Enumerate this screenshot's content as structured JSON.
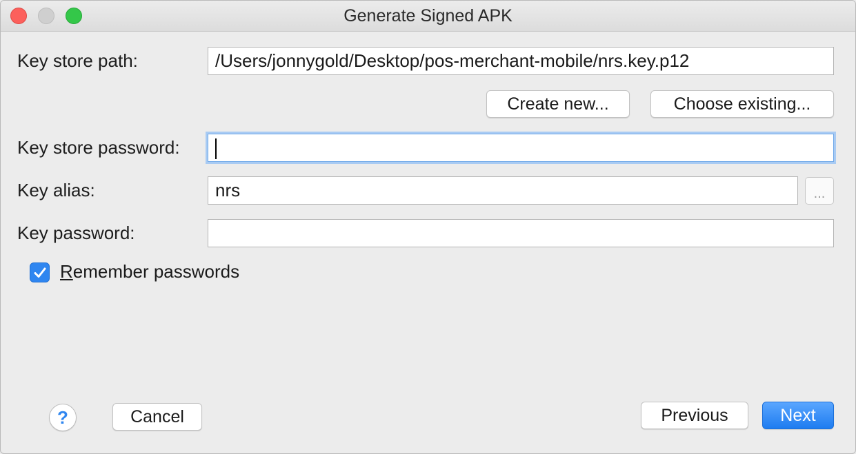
{
  "window": {
    "title": "Generate Signed APK"
  },
  "form": {
    "key_store_path_label": "Key store path:",
    "key_store_path_value": "/Users/jonnygold/Desktop/pos-merchant-mobile/nrs.key.p12",
    "create_new_label": "Create new...",
    "choose_existing_label": "Choose existing...",
    "key_store_password_label": "Key store password:",
    "key_store_password_value": "",
    "key_alias_label": "Key alias:",
    "key_alias_value": "nrs",
    "key_alias_browse_label": "...",
    "key_password_label": "Key password:",
    "key_password_value": "",
    "remember_passwords_mnemonic": "R",
    "remember_passwords_rest": "emember passwords",
    "remember_passwords_checked": true
  },
  "footer": {
    "help_label": "?",
    "cancel_label": "Cancel",
    "previous_label": "Previous",
    "next_label": "Next"
  },
  "colors": {
    "accent": "#2f86f0",
    "close": "#fc605c",
    "maximize": "#34c749",
    "minimize_inactive": "#cfcfcf"
  }
}
